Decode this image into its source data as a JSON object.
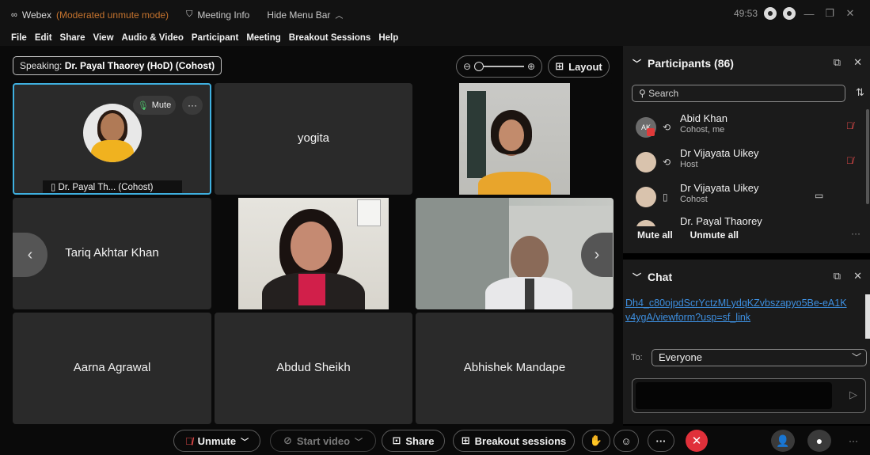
{
  "titlebar": {
    "app_name": "Webex",
    "mode": "(Moderated unmute mode)",
    "meeting_info": "Meeting Info",
    "hide_menu": "Hide Menu Bar",
    "timer": "49:53",
    "icons": {
      "logo": "webex-logo-icon",
      "info": "shield-icon",
      "chevron": "chevron-up-icon"
    }
  },
  "menu": [
    "File",
    "Edit",
    "Share",
    "View",
    "Audio & Video",
    "Participant",
    "Meeting",
    "Breakout Sessions",
    "Help"
  ],
  "stage": {
    "speaking_prefix": "Speaking:",
    "speaking_name": "Dr. Payal Thaorey (HoD) (Cohost)",
    "layout_label": "Layout",
    "tiles": [
      {
        "name": "Dr. Payal Th... (Cohost)",
        "mute_label": "Mute",
        "more": "···"
      },
      {
        "name": "yogita"
      },
      {
        "name": ""
      },
      {
        "name": "Tariq Akhtar Khan"
      },
      {
        "name": ""
      },
      {
        "name": ""
      },
      {
        "name": "Aarna Agrawal"
      },
      {
        "name": "Abdud Sheikh"
      },
      {
        "name": "Abhishek Mandape"
      }
    ]
  },
  "participants": {
    "title": "Participants (86)",
    "search_placeholder": "Search",
    "list": [
      {
        "initials": "AK",
        "name": "Abid Khan",
        "role": "Cohost, me"
      },
      {
        "initials": "",
        "name": "Dr Vijayata Uikey",
        "role": "Host"
      },
      {
        "initials": "",
        "name": "Dr Vijayata Uikey",
        "role": "Cohost"
      },
      {
        "initials": "",
        "name": "Dr. Payal Thaorey",
        "role": ""
      }
    ],
    "mute_all": "Mute all",
    "unmute_all": "Unmute all",
    "more": "···"
  },
  "chat": {
    "title": "Chat",
    "link_text": "Dh4_c80ojpdScrYctzMLydqKZvbszapyo5Be-eA1Kv4ygA/viewform?usp=sf_link",
    "to_label": "To:",
    "to_value": "Everyone"
  },
  "bottombar": {
    "unmute": "Unmute",
    "start_video": "Start video",
    "share": "Share",
    "breakout": "Breakout sessions",
    "end_icon": "close-icon",
    "more": "···"
  },
  "colors": {
    "accent_active": "#3fb0e0",
    "mode_orange": "#c5732e",
    "danger": "#e0303a",
    "link": "#3d8fe0"
  }
}
